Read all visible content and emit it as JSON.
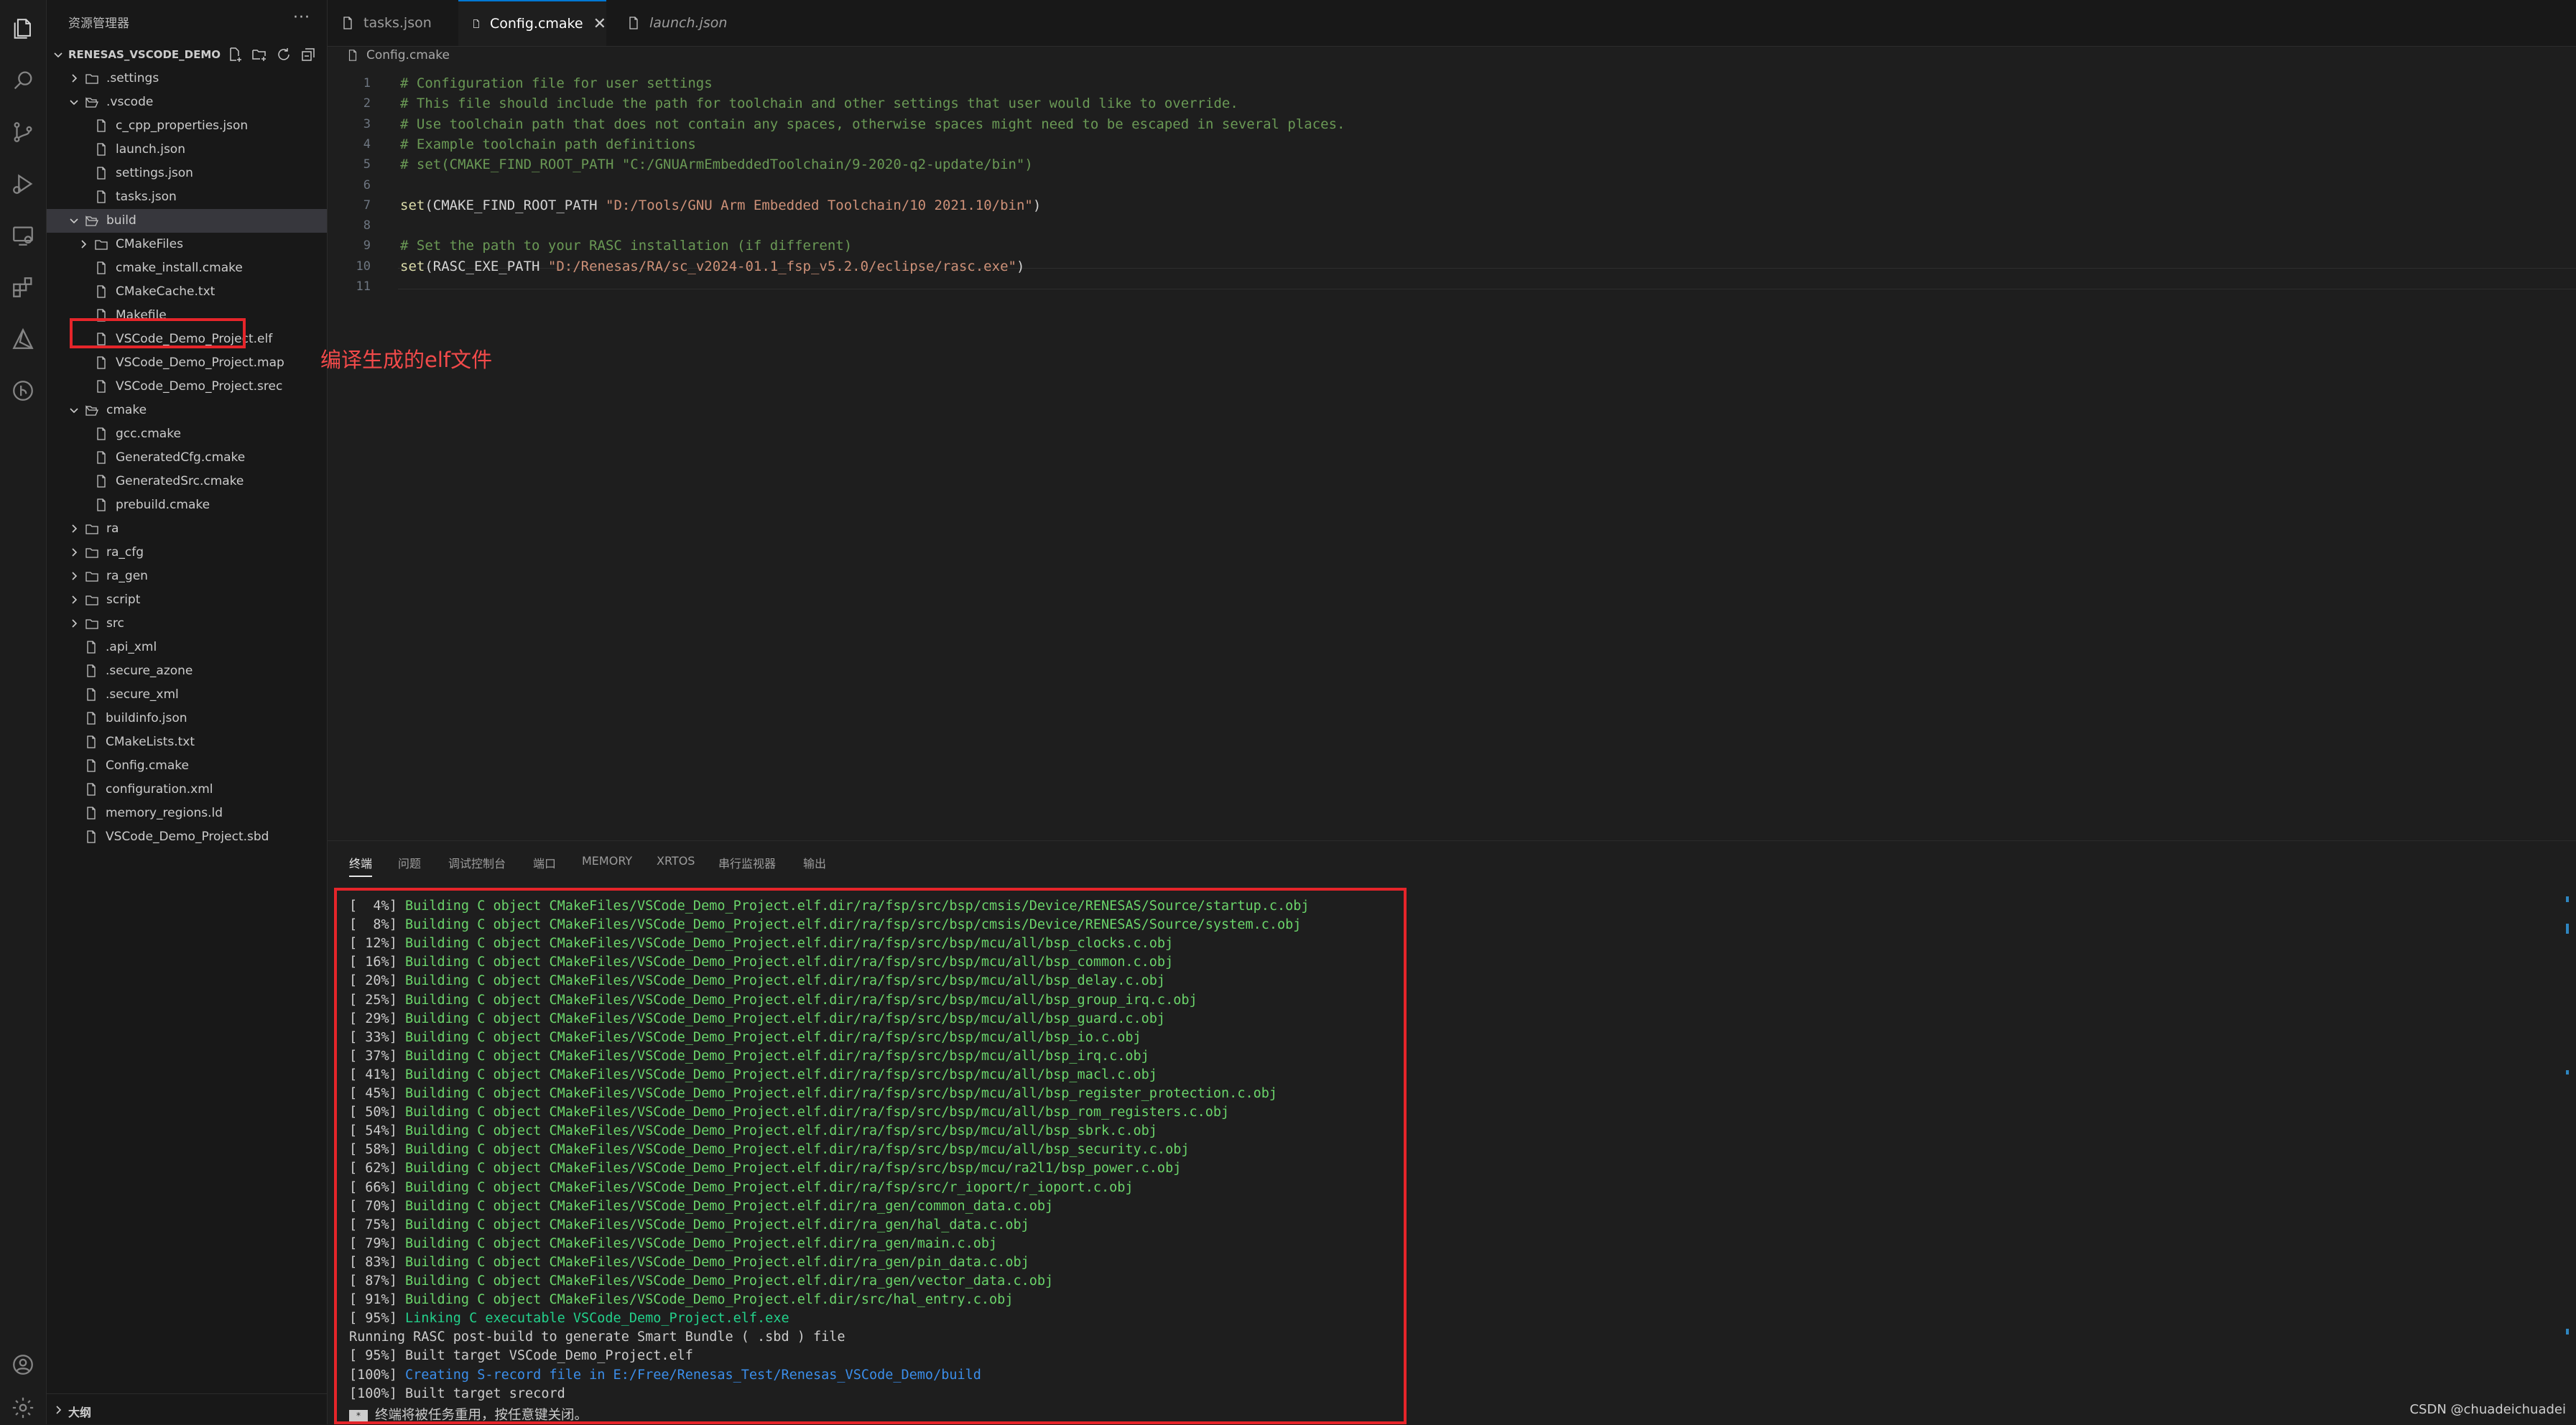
{
  "sidebar": {
    "title": "资源管理器",
    "more": "···",
    "root_label": "RENESAS_VSCODE_DEMO",
    "outline_label": "大纲",
    "tree": [
      {
        "label": ".settings",
        "type": "folder",
        "depth": 0,
        "expanded": false
      },
      {
        "label": ".vscode",
        "type": "folder",
        "depth": 0,
        "expanded": true
      },
      {
        "label": "c_cpp_properties.json",
        "type": "file",
        "depth": 1
      },
      {
        "label": "launch.json",
        "type": "file",
        "depth": 1
      },
      {
        "label": "settings.json",
        "type": "file",
        "depth": 1
      },
      {
        "label": "tasks.json",
        "type": "file",
        "depth": 1
      },
      {
        "label": "build",
        "type": "folder",
        "depth": 0,
        "expanded": true,
        "selected": true
      },
      {
        "label": "CMakeFiles",
        "type": "folder",
        "depth": 1,
        "expanded": false
      },
      {
        "label": "cmake_install.cmake",
        "type": "file",
        "depth": 1
      },
      {
        "label": "CMakeCache.txt",
        "type": "file",
        "depth": 1
      },
      {
        "label": "Makefile",
        "type": "file",
        "depth": 1
      },
      {
        "label": "VSCode_Demo_Project.elf",
        "type": "file",
        "depth": 1
      },
      {
        "label": "VSCode_Demo_Project.map",
        "type": "file",
        "depth": 1
      },
      {
        "label": "VSCode_Demo_Project.srec",
        "type": "file",
        "depth": 1
      },
      {
        "label": "cmake",
        "type": "folder",
        "depth": 0,
        "expanded": true
      },
      {
        "label": "gcc.cmake",
        "type": "file",
        "depth": 1
      },
      {
        "label": "GeneratedCfg.cmake",
        "type": "file",
        "depth": 1
      },
      {
        "label": "GeneratedSrc.cmake",
        "type": "file",
        "depth": 1
      },
      {
        "label": "prebuild.cmake",
        "type": "file",
        "depth": 1
      },
      {
        "label": "ra",
        "type": "folder",
        "depth": 0,
        "expanded": false
      },
      {
        "label": "ra_cfg",
        "type": "folder",
        "depth": 0,
        "expanded": false
      },
      {
        "label": "ra_gen",
        "type": "folder",
        "depth": 0,
        "expanded": false
      },
      {
        "label": "script",
        "type": "folder",
        "depth": 0,
        "expanded": false
      },
      {
        "label": "src",
        "type": "folder",
        "depth": 0,
        "expanded": false
      },
      {
        "label": ".api_xml",
        "type": "file",
        "depth": 0
      },
      {
        "label": ".secure_azone",
        "type": "file",
        "depth": 0
      },
      {
        "label": ".secure_xml",
        "type": "file",
        "depth": 0
      },
      {
        "label": "buildinfo.json",
        "type": "file",
        "depth": 0
      },
      {
        "label": "CMakeLists.txt",
        "type": "file",
        "depth": 0
      },
      {
        "label": "Config.cmake",
        "type": "file",
        "depth": 0
      },
      {
        "label": "configuration.xml",
        "type": "file",
        "depth": 0
      },
      {
        "label": "memory_regions.ld",
        "type": "file",
        "depth": 0
      },
      {
        "label": "VSCode_Demo_Project.sbd",
        "type": "file",
        "depth": 0
      }
    ]
  },
  "annotation": "编译生成的elf文件",
  "tabs": [
    {
      "label": "tasks.json",
      "active": false,
      "italic": false
    },
    {
      "label": "Config.cmake",
      "active": true,
      "italic": false,
      "close": "✕"
    },
    {
      "label": "launch.json",
      "active": false,
      "italic": true
    }
  ],
  "breadcrumb": "Config.cmake",
  "editor": {
    "lines": [
      {
        "n": "1",
        "parts": [
          {
            "t": "# Configuration file for user settings",
            "c": "cm"
          }
        ]
      },
      {
        "n": "2",
        "parts": [
          {
            "t": "# This file should include the path for toolchain and other settings that user would like to override.",
            "c": "cm"
          }
        ]
      },
      {
        "n": "3",
        "parts": [
          {
            "t": "# Use toolchain path that does not contain any spaces, otherwise spaces might need to be escaped in several places.",
            "c": "cm"
          }
        ]
      },
      {
        "n": "4",
        "parts": [
          {
            "t": "# Example toolchain path definitions",
            "c": "cm"
          }
        ]
      },
      {
        "n": "5",
        "parts": [
          {
            "t": "# set(CMAKE_FIND_ROOT_PATH \"C:/GNUArmEmbeddedToolchain/9-2020-q2-update/bin\")",
            "c": "cm"
          }
        ]
      },
      {
        "n": "6",
        "parts": []
      },
      {
        "n": "7",
        "parts": [
          {
            "t": "set",
            "c": "fn"
          },
          {
            "t": "(CMAKE_FIND_ROOT_PATH ",
            "c": "pl"
          },
          {
            "t": "\"D:/Tools/GNU Arm Embedded Toolchain/10 2021.10/bin\"",
            "c": "st"
          },
          {
            "t": ")",
            "c": "pl"
          }
        ]
      },
      {
        "n": "8",
        "parts": []
      },
      {
        "n": "9",
        "parts": [
          {
            "t": "# Set the path to your RASC installation (if different)",
            "c": "cm"
          }
        ]
      },
      {
        "n": "10",
        "parts": [
          {
            "t": "set",
            "c": "fn"
          },
          {
            "t": "(RASC_EXE_PATH ",
            "c": "pl"
          },
          {
            "t": "\"D:/Renesas/RA/sc_v2024-01.1_fsp_v5.2.0/eclipse/rasc.exe\"",
            "c": "st"
          },
          {
            "t": ")",
            "c": "pl"
          }
        ]
      },
      {
        "n": "11",
        "parts": []
      }
    ]
  },
  "panel": {
    "tabs": [
      "终端",
      "问题",
      "调试控制台",
      "端口",
      "MEMORY",
      "XRTOS",
      "串行监视器",
      "输出"
    ],
    "active_tab": "终端",
    "terminal": [
      {
        "pre": "[  4%] ",
        "txt": "Building C object CMakeFiles/VSCode_Demo_Project.elf.dir/ra/fsp/src/bsp/cmsis/Device/RENESAS/Source/startup.c.obj",
        "c": "g"
      },
      {
        "pre": "[  8%] ",
        "txt": "Building C object CMakeFiles/VSCode_Demo_Project.elf.dir/ra/fsp/src/bsp/cmsis/Device/RENESAS/Source/system.c.obj",
        "c": "g"
      },
      {
        "pre": "[ 12%] ",
        "txt": "Building C object CMakeFiles/VSCode_Demo_Project.elf.dir/ra/fsp/src/bsp/mcu/all/bsp_clocks.c.obj",
        "c": "g"
      },
      {
        "pre": "[ 16%] ",
        "txt": "Building C object CMakeFiles/VSCode_Demo_Project.elf.dir/ra/fsp/src/bsp/mcu/all/bsp_common.c.obj",
        "c": "g"
      },
      {
        "pre": "[ 20%] ",
        "txt": "Building C object CMakeFiles/VSCode_Demo_Project.elf.dir/ra/fsp/src/bsp/mcu/all/bsp_delay.c.obj",
        "c": "g"
      },
      {
        "pre": "[ 25%] ",
        "txt": "Building C object CMakeFiles/VSCode_Demo_Project.elf.dir/ra/fsp/src/bsp/mcu/all/bsp_group_irq.c.obj",
        "c": "g"
      },
      {
        "pre": "[ 29%] ",
        "txt": "Building C object CMakeFiles/VSCode_Demo_Project.elf.dir/ra/fsp/src/bsp/mcu/all/bsp_guard.c.obj",
        "c": "g"
      },
      {
        "pre": "[ 33%] ",
        "txt": "Building C object CMakeFiles/VSCode_Demo_Project.elf.dir/ra/fsp/src/bsp/mcu/all/bsp_io.c.obj",
        "c": "g"
      },
      {
        "pre": "[ 37%] ",
        "txt": "Building C object CMakeFiles/VSCode_Demo_Project.elf.dir/ra/fsp/src/bsp/mcu/all/bsp_irq.c.obj",
        "c": "g"
      },
      {
        "pre": "[ 41%] ",
        "txt": "Building C object CMakeFiles/VSCode_Demo_Project.elf.dir/ra/fsp/src/bsp/mcu/all/bsp_macl.c.obj",
        "c": "g"
      },
      {
        "pre": "[ 45%] ",
        "txt": "Building C object CMakeFiles/VSCode_Demo_Project.elf.dir/ra/fsp/src/bsp/mcu/all/bsp_register_protection.c.obj",
        "c": "g"
      },
      {
        "pre": "[ 50%] ",
        "txt": "Building C object CMakeFiles/VSCode_Demo_Project.elf.dir/ra/fsp/src/bsp/mcu/all/bsp_rom_registers.c.obj",
        "c": "g"
      },
      {
        "pre": "[ 54%] ",
        "txt": "Building C object CMakeFiles/VSCode_Demo_Project.elf.dir/ra/fsp/src/bsp/mcu/all/bsp_sbrk.c.obj",
        "c": "g"
      },
      {
        "pre": "[ 58%] ",
        "txt": "Building C object CMakeFiles/VSCode_Demo_Project.elf.dir/ra/fsp/src/bsp/mcu/all/bsp_security.c.obj",
        "c": "g"
      },
      {
        "pre": "[ 62%] ",
        "txt": "Building C object CMakeFiles/VSCode_Demo_Project.elf.dir/ra/fsp/src/bsp/mcu/ra2l1/bsp_power.c.obj",
        "c": "g"
      },
      {
        "pre": "[ 66%] ",
        "txt": "Building C object CMakeFiles/VSCode_Demo_Project.elf.dir/ra/fsp/src/r_ioport/r_ioport.c.obj",
        "c": "g"
      },
      {
        "pre": "[ 70%] ",
        "txt": "Building C object CMakeFiles/VSCode_Demo_Project.elf.dir/ra_gen/common_data.c.obj",
        "c": "g"
      },
      {
        "pre": "[ 75%] ",
        "txt": "Building C object CMakeFiles/VSCode_Demo_Project.elf.dir/ra_gen/hal_data.c.obj",
        "c": "g"
      },
      {
        "pre": "[ 79%] ",
        "txt": "Building C object CMakeFiles/VSCode_Demo_Project.elf.dir/ra_gen/main.c.obj",
        "c": "g"
      },
      {
        "pre": "[ 83%] ",
        "txt": "Building C object CMakeFiles/VSCode_Demo_Project.elf.dir/ra_gen/pin_data.c.obj",
        "c": "g"
      },
      {
        "pre": "[ 87%] ",
        "txt": "Building C object CMakeFiles/VSCode_Demo_Project.elf.dir/ra_gen/vector_data.c.obj",
        "c": "g"
      },
      {
        "pre": "[ 91%] ",
        "txt": "Building C object CMakeFiles/VSCode_Demo_Project.elf.dir/src/hal_entry.c.obj",
        "c": "g"
      },
      {
        "pre": "[ 95%] ",
        "txt": "Linking C executable VSCode_Demo_Project.elf.exe",
        "c": "c"
      },
      {
        "pre": "",
        "txt": "Running RASC post-build to generate Smart Bundle ( .sbd ) file",
        "c": ""
      },
      {
        "pre": "[ 95%] ",
        "txt": "Built target VSCode_Demo_Project.elf",
        "c": ""
      },
      {
        "pre": "[100%] ",
        "txt": "Creating S-record file in E:/Free/Renesas_Test/Renesas_VSCode_Demo/build",
        "c": "b"
      },
      {
        "pre": "[100%] ",
        "txt": "Built target srecord",
        "c": ""
      }
    ],
    "last_glyph": "*",
    "last_line": "终端将被任务重用，按任意键关闭。"
  },
  "credit": "CSDN @chuadeichuadei",
  "colors": {
    "accent": "#0078d4",
    "highlight": "#e5252a",
    "annotation": "#f24a4a"
  }
}
